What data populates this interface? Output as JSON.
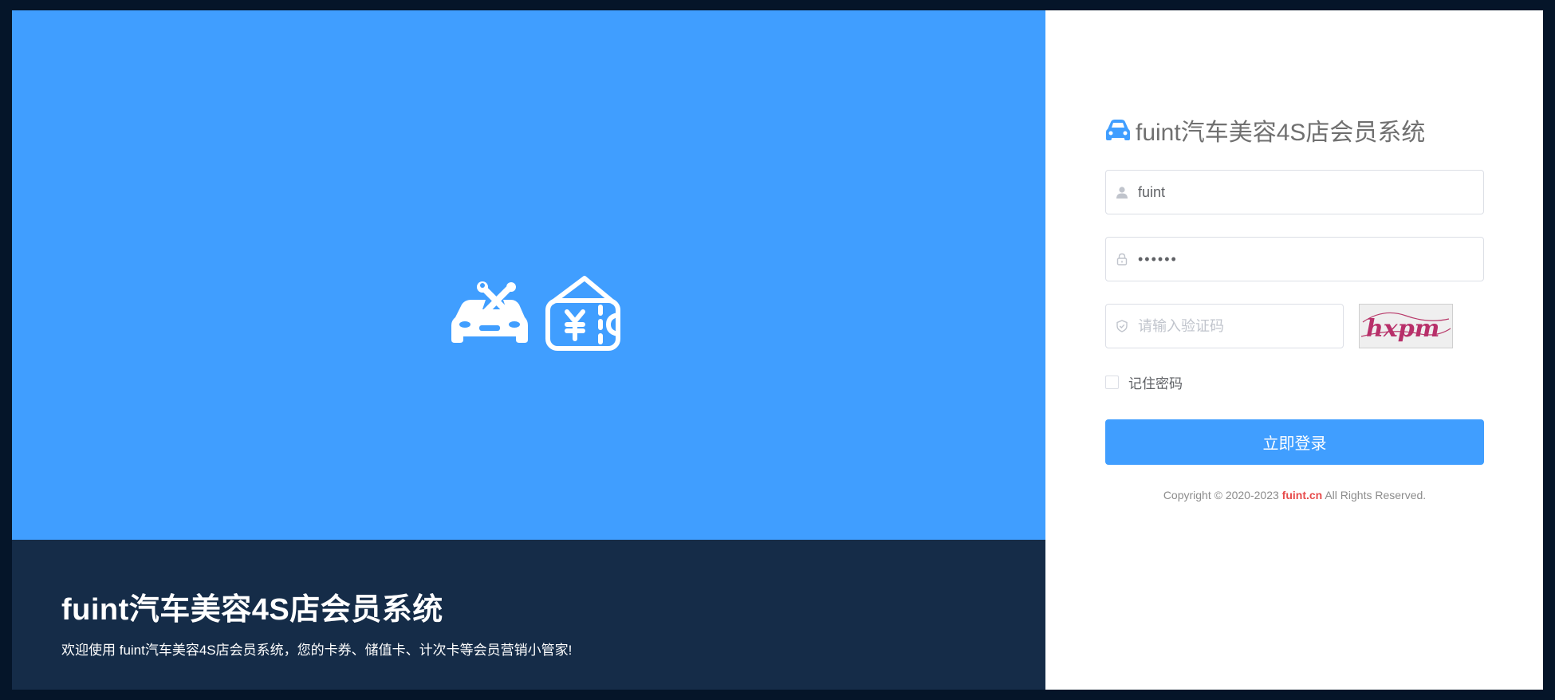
{
  "colors": {
    "background": "#051529",
    "hero": "#409eff",
    "footer_band": "#152c48",
    "primary": "#409eff",
    "link_red": "#e74c4c"
  },
  "hero": {
    "icons": [
      "car-repair-icon",
      "wallet-coupon-icon"
    ],
    "title": "fuint汽车美容4S店会员系统",
    "subtitle": "欢迎使用 fuint汽车美容4S店会员系统，您的卡券、储值卡、计次卡等会员营销小管家!"
  },
  "login": {
    "brand_icon": "car-icon",
    "brand_title": "fuint汽车美容4S店会员系统",
    "username": {
      "value": "fuint",
      "icon": "user-icon"
    },
    "password": {
      "display": "••••••",
      "icon": "lock-icon"
    },
    "captcha": {
      "placeholder": "请输入验证码",
      "icon": "shield-check-icon",
      "image_text": "hxpm"
    },
    "remember_label": "记住密码",
    "submit_label": "立即登录",
    "copyright_prefix": "Copyright © 2020-2023",
    "copyright_link": "fuint.cn",
    "copyright_suffix": "All Rights Reserved."
  }
}
